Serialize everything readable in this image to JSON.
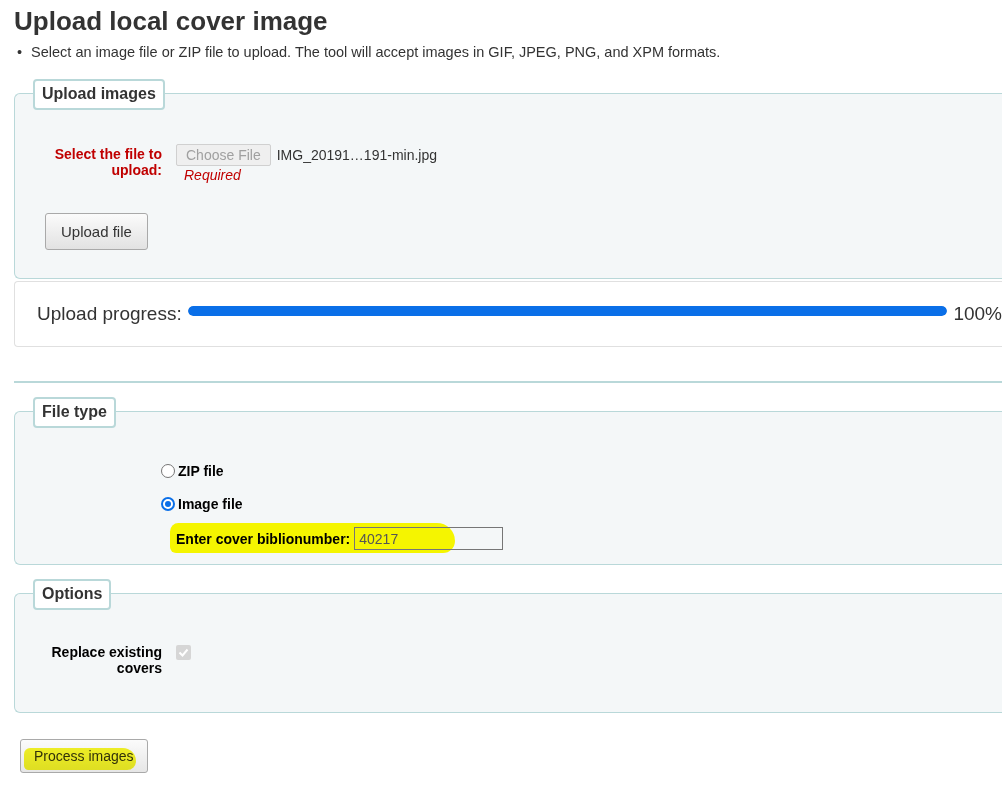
{
  "title": "Upload local cover image",
  "intro_bullet": "•",
  "intro": "Select an image file or ZIP file to upload. The tool will accept images in GIF, JPEG, PNG, and XPM formats.",
  "upload_images": {
    "legend": "Upload images",
    "file_label": "Select the file to upload:",
    "choose_button": {
      "label": "Choose File",
      "disabled": true
    },
    "file_name": "IMG_20191…191-min.jpg",
    "required_note": "Required",
    "upload_button": "Upload file"
  },
  "upload_progress": {
    "label": "Upload progress:",
    "level": 1.0,
    "reading": "100%"
  },
  "file_type": {
    "legend": "File type",
    "options": [
      {
        "label": "ZIP file",
        "selected": false
      },
      {
        "label": "Image file",
        "selected": true
      }
    ],
    "biblionumber": {
      "label": "Enter cover biblionumber:",
      "value": "40217",
      "highlighted": true
    }
  },
  "options": {
    "legend": "Options",
    "replace_existing": {
      "label": "Replace existing covers",
      "checked": true,
      "disabled": true
    }
  },
  "process_button": {
    "label": "Process images",
    "highlighted": true
  }
}
